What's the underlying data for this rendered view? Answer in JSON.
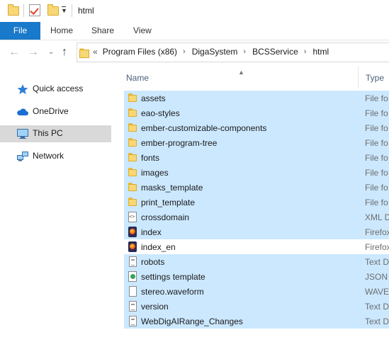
{
  "window": {
    "title": "html"
  },
  "ribbon": {
    "tabs": [
      {
        "label": "File"
      },
      {
        "label": "Home"
      },
      {
        "label": "Share"
      },
      {
        "label": "View"
      }
    ]
  },
  "address": {
    "overflow": "«",
    "crumbs": [
      "Program Files (x86)",
      "DigaSystem",
      "BCSService",
      "html"
    ]
  },
  "sidebar": {
    "items": [
      {
        "label": "Quick access",
        "icon": "star-icon"
      },
      {
        "label": "OneDrive",
        "icon": "cloud-icon"
      },
      {
        "label": "This PC",
        "icon": "computer-icon",
        "selected": true
      },
      {
        "label": "Network",
        "icon": "network-icon"
      }
    ]
  },
  "columns": {
    "name": "Name",
    "type": "Type"
  },
  "files": [
    {
      "name": "assets",
      "type": "File fo",
      "icon": "folder",
      "selected": true
    },
    {
      "name": "eao-styles",
      "type": "File fo",
      "icon": "folder",
      "selected": true
    },
    {
      "name": "ember-customizable-components",
      "type": "File fo",
      "icon": "folder",
      "selected": true
    },
    {
      "name": "ember-program-tree",
      "type": "File fo",
      "icon": "folder",
      "selected": true
    },
    {
      "name": "fonts",
      "type": "File fo",
      "icon": "folder",
      "selected": true
    },
    {
      "name": "images",
      "type": "File fo",
      "icon": "folder",
      "selected": true
    },
    {
      "name": "masks_template",
      "type": "File fo",
      "icon": "folder",
      "selected": true
    },
    {
      "name": "print_template",
      "type": "File fo",
      "icon": "folder",
      "selected": true
    },
    {
      "name": "crossdomain",
      "type": "XML D",
      "icon": "xml",
      "selected": true
    },
    {
      "name": "index",
      "type": "Firefox",
      "icon": "firefox",
      "selected": true
    },
    {
      "name": "index_en",
      "type": "Firefox",
      "icon": "firefox",
      "selected": false
    },
    {
      "name": "robots",
      "type": "Text D",
      "icon": "text",
      "selected": true
    },
    {
      "name": "settings template",
      "type": "JSON F",
      "icon": "json",
      "selected": true
    },
    {
      "name": "stereo.waveform",
      "type": "WAVEF",
      "icon": "blank",
      "selected": true
    },
    {
      "name": "version",
      "type": "Text D",
      "icon": "text",
      "selected": true
    },
    {
      "name": "WebDigAIRange_Changes",
      "type": "Text D",
      "icon": "text",
      "selected": true
    }
  ],
  "colors": {
    "accent": "#1979ca",
    "selection": "#cce8ff",
    "sidebar_selected": "#d9d9d9"
  }
}
